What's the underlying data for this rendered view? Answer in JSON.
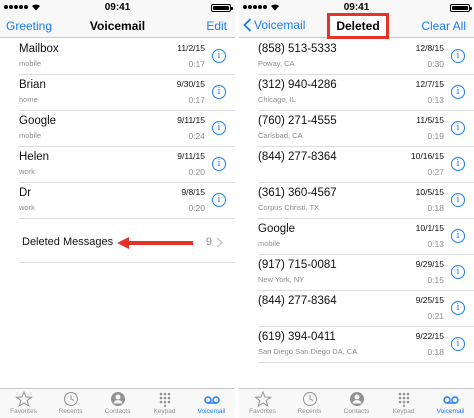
{
  "left": {
    "status": {
      "time": "09:41"
    },
    "nav": {
      "left": "Greeting",
      "title": "Voicemail",
      "right": "Edit"
    },
    "rows": [
      {
        "name": "Mailbox",
        "sub": "mobile",
        "date": "11/2/15",
        "dur": "0:17"
      },
      {
        "name": "Brian",
        "sub": "home",
        "date": "9/30/15",
        "dur": "0:17"
      },
      {
        "name": "Google",
        "sub": "mobile",
        "date": "9/11/15",
        "dur": "0:24"
      },
      {
        "name": "Helen",
        "sub": "work",
        "date": "9/11/15",
        "dur": "0:20"
      },
      {
        "name": "Dr",
        "sub": "work",
        "date": "9/8/15",
        "dur": "0:20"
      }
    ],
    "deleted": {
      "label": "Deleted Messages",
      "count": "9"
    }
  },
  "right": {
    "status": {
      "time": "09:41"
    },
    "nav": {
      "back": "Voicemail",
      "title": "Deleted",
      "right": "Clear All"
    },
    "rows": [
      {
        "name": "(858) 513-5333",
        "sub": "Poway, CA",
        "date": "12/8/15",
        "dur": "0:30"
      },
      {
        "name": "(312) 940-4286",
        "sub": "Chicago, IL",
        "date": "12/7/15",
        "dur": "0:13"
      },
      {
        "name": "(760) 271-4555",
        "sub": "Carlsbad, CA",
        "date": "11/5/15",
        "dur": "0:19"
      },
      {
        "name": "(844) 277-8364",
        "sub": "",
        "date": "10/16/15",
        "dur": "0:27"
      },
      {
        "name": "(361) 360-4567",
        "sub": "Corpus Christi, TX",
        "date": "10/5/15",
        "dur": "0:18"
      },
      {
        "name": "Google",
        "sub": "mobile",
        "date": "10/1/15",
        "dur": "0:13"
      },
      {
        "name": "(917) 715-0081",
        "sub": "New York, NY",
        "date": "9/29/15",
        "dur": "0:15"
      },
      {
        "name": "(844) 277-8364",
        "sub": "",
        "date": "9/25/15",
        "dur": "0:21"
      },
      {
        "name": "(619) 394-0411",
        "sub": "San Diego San Diego DA, CA",
        "date": "9/22/15",
        "dur": "0:18"
      }
    ]
  },
  "tabs": [
    {
      "label": "Favorites",
      "icon": "star-icon"
    },
    {
      "label": "Recents",
      "icon": "clock-icon"
    },
    {
      "label": "Contacts",
      "icon": "person-icon"
    },
    {
      "label": "Keypad",
      "icon": "keypad-icon"
    },
    {
      "label": "Voicemail",
      "icon": "voicemail-icon"
    }
  ],
  "colors": {
    "accent": "#1a7cf2",
    "highlight": "#e6332a"
  }
}
